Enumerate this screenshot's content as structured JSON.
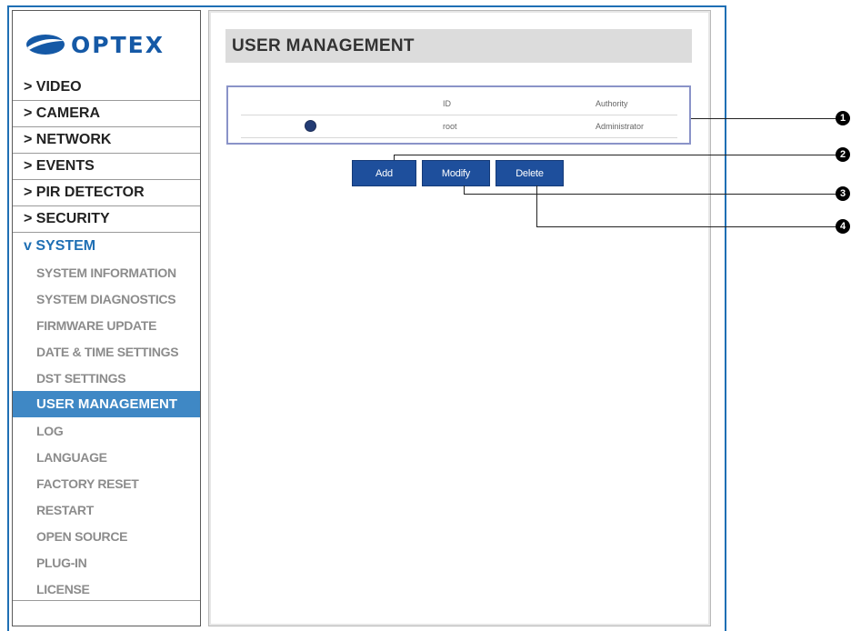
{
  "brand": {
    "name": "OPTEX",
    "logo_icon": "optex-swoosh-logo",
    "color": "#1559a6"
  },
  "sidebar": {
    "top_items": [
      {
        "label": "> VIDEO"
      },
      {
        "label": "> CAMERA"
      },
      {
        "label": "> NETWORK"
      },
      {
        "label": "> EVENTS"
      },
      {
        "label": "> PIR DETECTOR"
      },
      {
        "label": "> SECURITY"
      },
      {
        "label": "v SYSTEM",
        "active": true
      }
    ],
    "system_items": [
      {
        "label": "SYSTEM INFORMATION"
      },
      {
        "label": "SYSTEM DIAGNOSTICS"
      },
      {
        "label": "FIRMWARE UPDATE"
      },
      {
        "label": "DATE & TIME SETTINGS"
      },
      {
        "label": "DST SETTINGS"
      },
      {
        "label": "USER MANAGEMENT",
        "selected": true
      },
      {
        "label": "LOG"
      },
      {
        "label": "LANGUAGE"
      },
      {
        "label": "FACTORY RESET"
      },
      {
        "label": "RESTART"
      },
      {
        "label": "OPEN SOURCE"
      },
      {
        "label": "PLUG-IN"
      },
      {
        "label": "LICENSE"
      }
    ]
  },
  "main": {
    "title": "USER MANAGEMENT",
    "table": {
      "headers": {
        "id": "ID",
        "authority": "Authority"
      },
      "rows": [
        {
          "selected": true,
          "id": "root",
          "authority": "Administrator"
        }
      ]
    },
    "buttons": {
      "add": "Add",
      "modify": "Modify",
      "delete": "Delete"
    }
  },
  "callouts": [
    "1",
    "2",
    "3",
    "4"
  ],
  "colors": {
    "frame": "#1f6fb4",
    "selected_bg": "#3f88c5",
    "button_bg": "#1e4f9c"
  }
}
